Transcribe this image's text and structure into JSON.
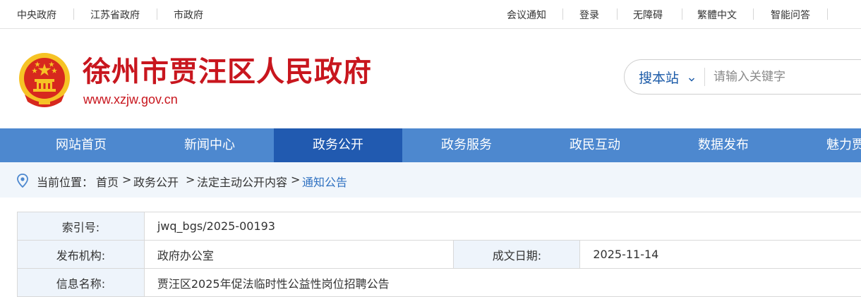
{
  "topbar": {
    "left_links": [
      "中央政府",
      "江苏省政府",
      "市政府"
    ],
    "right_links": [
      "会议通知",
      "登录",
      "无障碍",
      "繁體中文",
      "智能问答"
    ]
  },
  "header": {
    "title": "徐州市贾汪区人民政府",
    "url": "www.xzjw.gov.cn",
    "colors": {
      "title": "#c8161e",
      "emblem_red": "#d7281e",
      "emblem_gold": "#f6c325"
    },
    "emblem_icon": "national-emblem-icon"
  },
  "search": {
    "scope_label": "搜本站",
    "placeholder": "请输入关键字",
    "scope_icon": "chevron-down-icon"
  },
  "nav": {
    "items": [
      "网站首页",
      "新闻中心",
      "政务公开",
      "政务服务",
      "政民互动",
      "数据发布",
      "魅力贾汪"
    ],
    "active_index": 2,
    "colors": {
      "bar": "#4d88cf",
      "active": "#215ab0"
    }
  },
  "breadcrumb": {
    "icon": "location-pin-icon",
    "label": "当前位置：",
    "items": [
      "首页",
      "政务公开",
      "法定主动公开内容",
      "通知公告"
    ],
    "separator": ">"
  },
  "info": {
    "index_label": "索引号:",
    "index_value": "jwq_bgs/2025-00193",
    "org_label": "发布机构:",
    "org_value": "政府办公室",
    "date_label": "成文日期:",
    "date_value": "2025-11-14",
    "name_label": "信息名称:",
    "name_value": "贾汪区2025年促法临时性公益性岗位招聘公告"
  }
}
